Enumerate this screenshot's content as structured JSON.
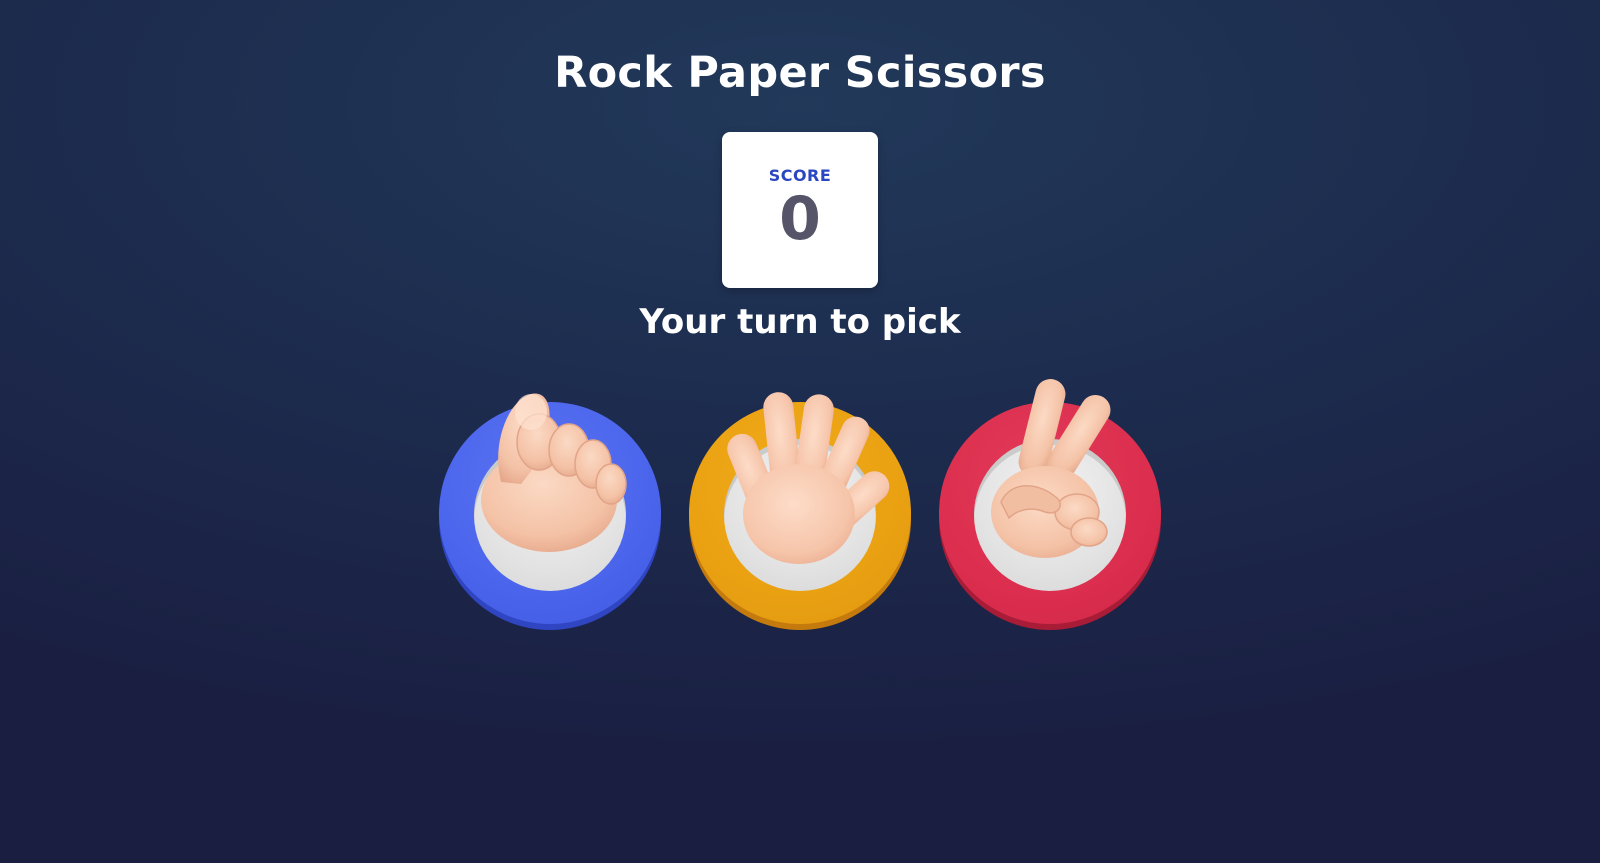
{
  "game": {
    "title": "Rock Paper Scissors",
    "prompt": "Your turn to pick"
  },
  "score": {
    "label": "SCORE",
    "value": "0"
  },
  "choices": [
    {
      "name": "rock",
      "icon": "fist-hand-icon",
      "color": "#4a64ec"
    },
    {
      "name": "paper",
      "icon": "open-hand-icon",
      "color": "#e9a112"
    },
    {
      "name": "scissors",
      "icon": "victory-hand-icon",
      "color": "#dc2e4e"
    }
  ],
  "colors": {
    "background": "#1d2d4f",
    "score_label": "#2a46c0",
    "score_value": "#565468",
    "skin": "#f6c7ad"
  }
}
